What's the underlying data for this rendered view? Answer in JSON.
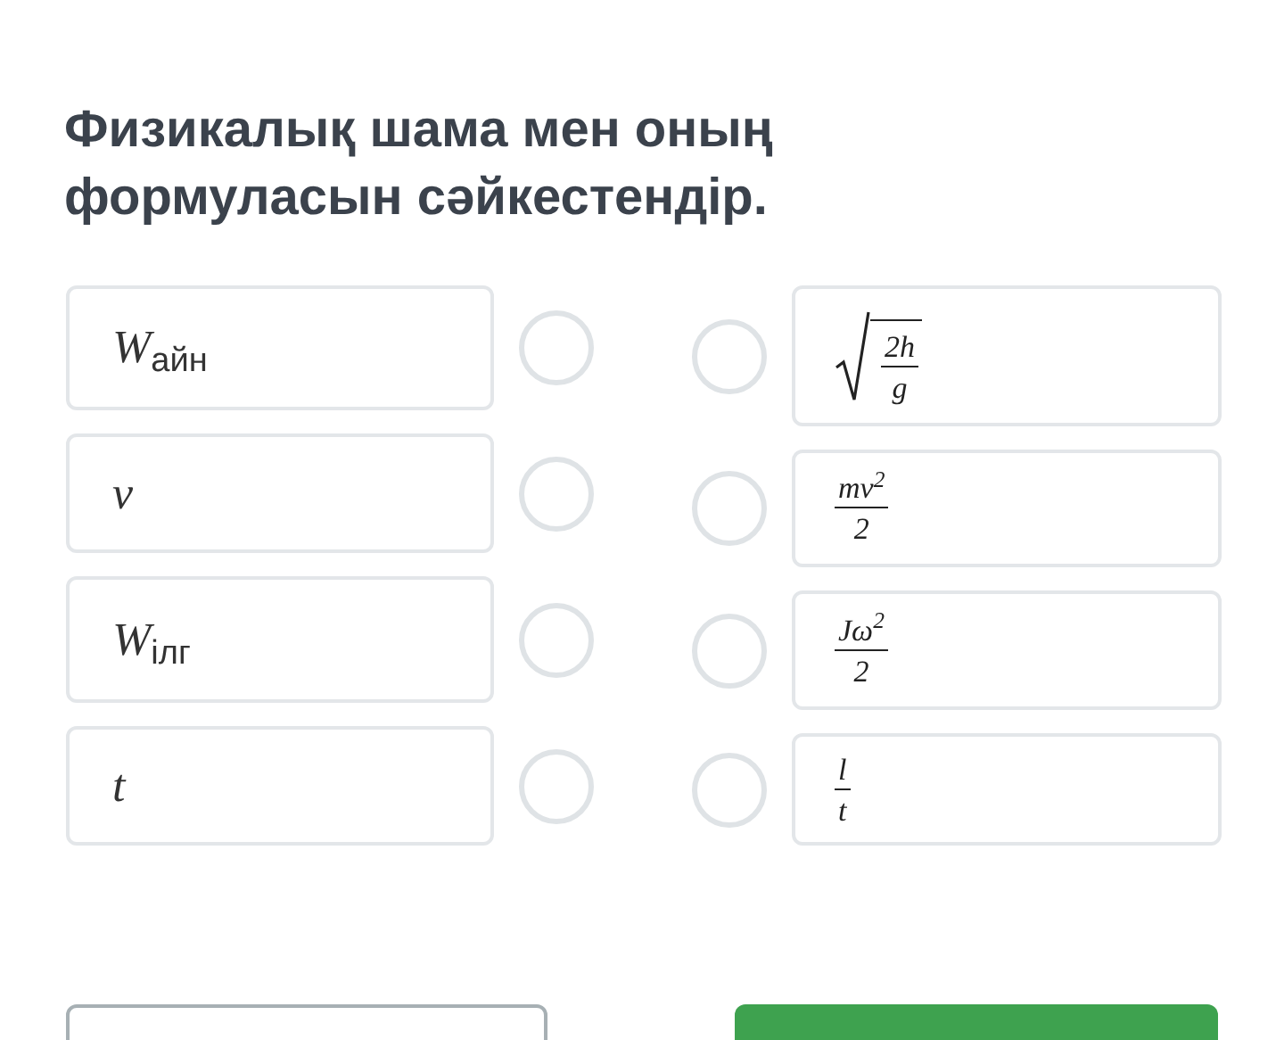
{
  "title": "Физикалық шама мен оның формуласын сәйкестендір.",
  "quantities": [
    {
      "symbol": "W",
      "subscript": "айн",
      "selected": false
    },
    {
      "symbol": "v",
      "selected": false
    },
    {
      "symbol": "W",
      "subscript": "ілг",
      "selected": false
    },
    {
      "symbol": "t",
      "selected": false
    }
  ],
  "formulas": [
    {
      "kind": "sqrt_fraction",
      "numerator": "2h",
      "denominator": "g",
      "selected": false
    },
    {
      "kind": "fraction",
      "numerator": "mv$^{2}$",
      "denominator": "2",
      "selected": false
    },
    {
      "kind": "fraction",
      "numerator": "Jω$^{2}$",
      "denominator": "2",
      "selected": false
    },
    {
      "kind": "fraction",
      "numerator": "l",
      "denominator": "t",
      "selected": false
    }
  ],
  "buttons": [
    {
      "kind": "outline"
    },
    {
      "kind": "primary"
    }
  ]
}
